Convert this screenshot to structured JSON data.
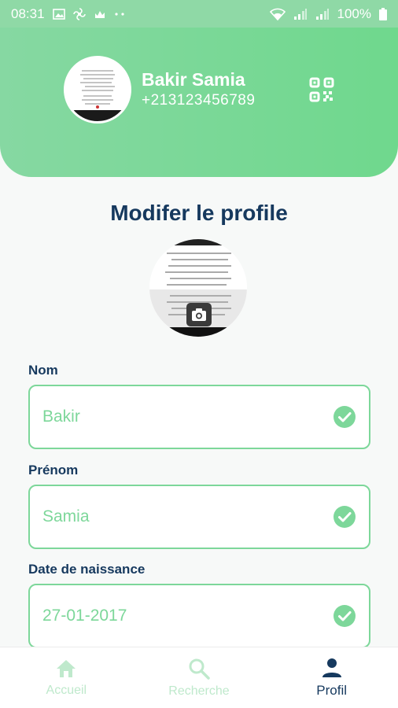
{
  "status_bar": {
    "time": "08:31",
    "battery": "100%",
    "icons": [
      "image-icon",
      "pinwheel-icon",
      "cloud-icon",
      "more-icon",
      "wifi-icon",
      "signal-icon",
      "signal-icon-2",
      "battery-icon"
    ]
  },
  "header": {
    "name": "Bakir Samia",
    "phone": "+213123456789",
    "qr_icon": "qr-code-icon"
  },
  "page": {
    "title": "Modifer le profile"
  },
  "form": {
    "fields": [
      {
        "label": "Nom",
        "value": "Bakir"
      },
      {
        "label": "Prénom",
        "value": "Samia"
      },
      {
        "label": "Date de naissance",
        "value": "27-01-2017"
      }
    ]
  },
  "nav": {
    "items": [
      {
        "label": "Accueil",
        "icon": "home-icon",
        "active": false
      },
      {
        "label": "Recherche",
        "icon": "search-icon",
        "active": false
      },
      {
        "label": "Profil",
        "icon": "person-icon",
        "active": true
      }
    ]
  },
  "colors": {
    "accent": "#7dd79a",
    "header_green": "#78d894",
    "title_navy": "#16395e"
  }
}
